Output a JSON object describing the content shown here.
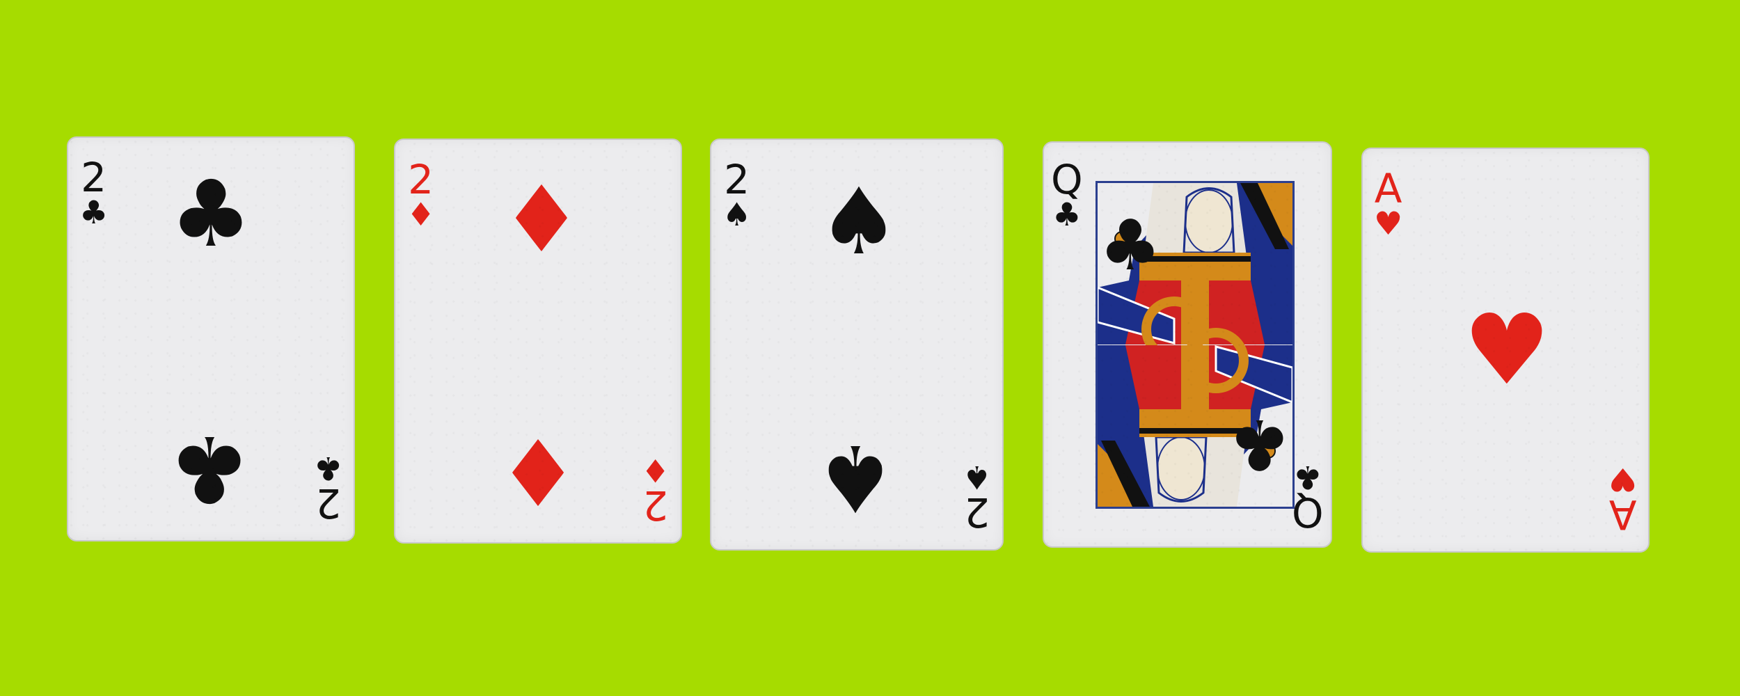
{
  "background_color": "#a6dc00",
  "cards": [
    {
      "rank": "2",
      "suit_symbol": "♣",
      "suit": "clubs",
      "color": "black"
    },
    {
      "rank": "2",
      "suit_symbol": "♦",
      "suit": "diamonds",
      "color": "red"
    },
    {
      "rank": "2",
      "suit_symbol": "♠",
      "suit": "spades",
      "color": "black"
    },
    {
      "rank": "Q",
      "suit_symbol": "♣",
      "suit": "clubs",
      "color": "black"
    },
    {
      "rank": "A",
      "suit_symbol": "♥",
      "suit": "hearts",
      "color": "red"
    }
  ]
}
